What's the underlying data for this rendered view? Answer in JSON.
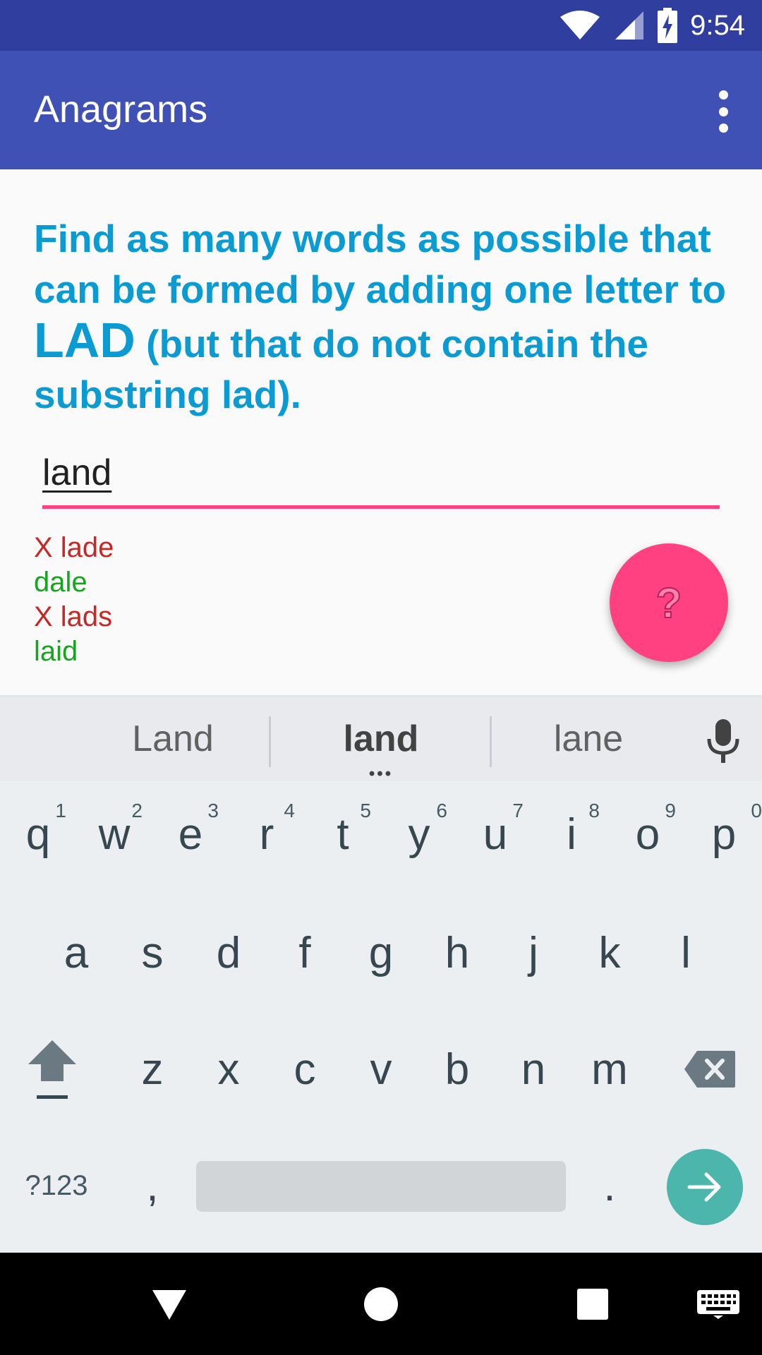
{
  "status_bar": {
    "time": "9:54",
    "icons": [
      "wifi-icon",
      "cell-signal-icon",
      "battery-charging-icon"
    ]
  },
  "app_bar": {
    "title": "Anagrams",
    "menu_icon": "overflow-menu-icon"
  },
  "game": {
    "instructions_start": "Find as many words as possible that can be formed by adding one letter to ",
    "base_word": "LAD",
    "instructions_end": " (but that do not contain the substring lad).",
    "input_value": "land",
    "results": [
      {
        "text": "X lade",
        "status": "invalid"
      },
      {
        "text": "dale",
        "status": "valid"
      },
      {
        "text": "X lads",
        "status": "invalid"
      },
      {
        "text": "laid",
        "status": "valid"
      }
    ],
    "fab_label": "?",
    "colors": {
      "instructions": "#0a9bd2",
      "accent": "#ff4081",
      "invalid": "#c62828",
      "valid": "#16a521",
      "app_bar": "#3f51b5"
    }
  },
  "keyboard": {
    "suggestions": [
      "Land",
      "land",
      "lane"
    ],
    "row1": [
      {
        "key": "q",
        "hint": "1"
      },
      {
        "key": "w",
        "hint": "2"
      },
      {
        "key": "e",
        "hint": "3"
      },
      {
        "key": "r",
        "hint": "4"
      },
      {
        "key": "t",
        "hint": "5"
      },
      {
        "key": "y",
        "hint": "6"
      },
      {
        "key": "u",
        "hint": "7"
      },
      {
        "key": "i",
        "hint": "8"
      },
      {
        "key": "o",
        "hint": "9"
      },
      {
        "key": "p",
        "hint": "0"
      }
    ],
    "row2": [
      "a",
      "s",
      "d",
      "f",
      "g",
      "h",
      "j",
      "k",
      "l"
    ],
    "row3": [
      "z",
      "x",
      "c",
      "v",
      "b",
      "n",
      "m"
    ],
    "symbols_label": "?123",
    "comma": ",",
    "period": "."
  },
  "nav_bar": {
    "buttons": [
      "back-icon",
      "home-icon",
      "recents-icon",
      "keyboard-switch-icon"
    ]
  }
}
